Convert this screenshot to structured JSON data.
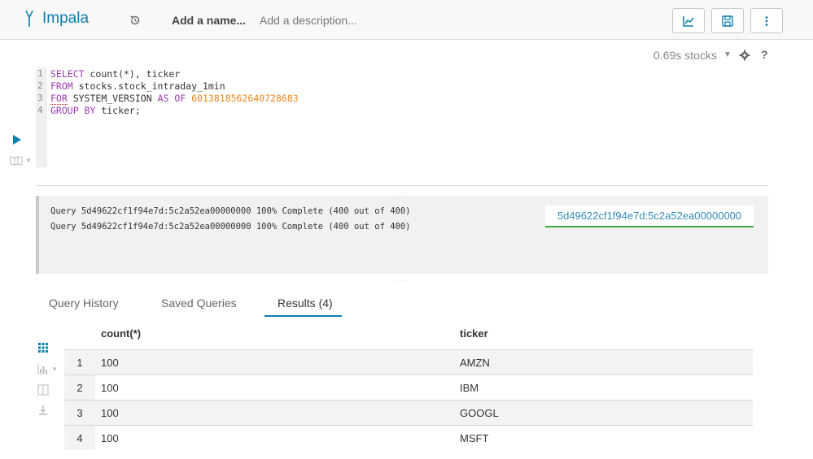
{
  "header": {
    "app_name": "Impala",
    "name_placeholder": "Add a name...",
    "description_placeholder": "Add a description..."
  },
  "editor": {
    "execution_time": "0.69s stocks",
    "line_numbers": [
      "1",
      "2",
      "3",
      "4"
    ],
    "lines": [
      {
        "kw1": "SELECT",
        "rest": " count(*), ticker"
      },
      {
        "kw1": "FROM",
        "rest": " stocks.stock_intraday_1min"
      },
      {
        "kw1": "FOR",
        "mid1": " SYSTEM_VERSION ",
        "kw2": "AS",
        "mid2": " ",
        "kw3": "OF",
        "mid3": " ",
        "num": "6013818562640728683"
      },
      {
        "kw1": "GROUP BY",
        "rest": " ticker;"
      }
    ],
    "help_label": "?"
  },
  "log": {
    "lines": [
      "Query 5d49622cf1f94e7d:5c2a52ea00000000 100% Complete (400 out of 400)",
      "Query 5d49622cf1f94e7d:5c2a52ea00000000 100% Complete (400 out of 400)"
    ],
    "query_id": "5d49622cf1f94e7d:5c2a52ea00000000"
  },
  "tabs": [
    {
      "label": "Query History",
      "active": false
    },
    {
      "label": "Saved Queries",
      "active": false
    },
    {
      "label": "Results (4)",
      "active": true
    }
  ],
  "results": {
    "columns": [
      "count(*)",
      "ticker"
    ],
    "rows": [
      {
        "index": "1",
        "count": "100",
        "ticker": "AMZN"
      },
      {
        "index": "2",
        "count": "100",
        "ticker": "IBM"
      },
      {
        "index": "3",
        "count": "100",
        "ticker": "GOOGL"
      },
      {
        "index": "4",
        "count": "100",
        "ticker": "MSFT"
      }
    ]
  },
  "colors": {
    "accent": "#0b7fad",
    "keyword": "#9b3bb2",
    "number": "#e8861a",
    "success": "#3aad3a"
  },
  "icons": [
    "impala-logo-icon",
    "history-icon",
    "chart-icon",
    "save-icon",
    "more-vertical-icon",
    "chevron-down-icon",
    "gear-icon",
    "help-icon",
    "play-icon",
    "book-icon",
    "grid-icon",
    "bar-chart-icon",
    "columns-icon",
    "download-icon"
  ]
}
